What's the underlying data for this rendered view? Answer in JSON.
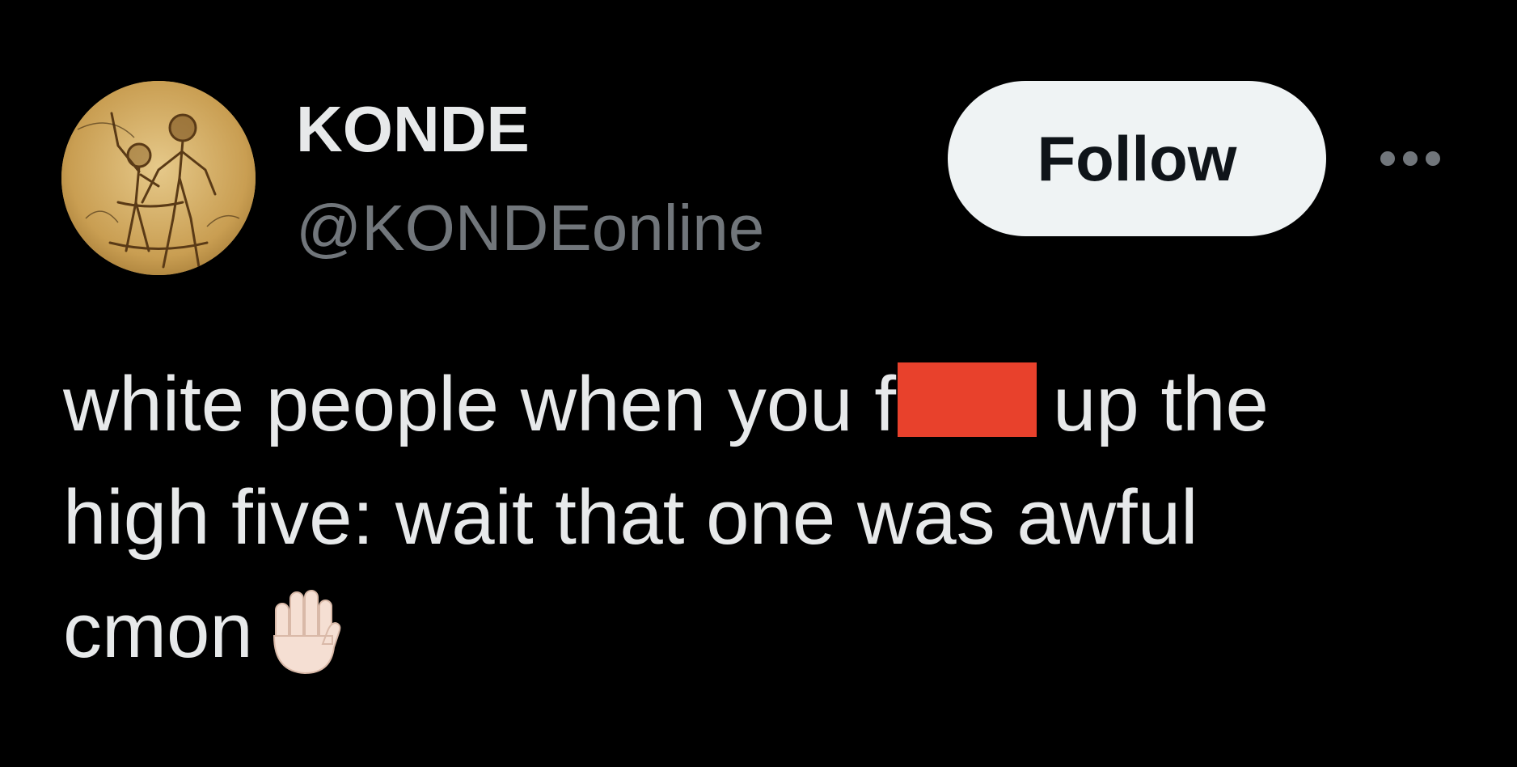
{
  "tweet": {
    "author": {
      "display_name": "KONDE",
      "handle": "@KONDEonline",
      "avatar_icon": "sketch-figures-avatar"
    },
    "follow_label": "Follow",
    "more_icon": "more-horizontal-icon",
    "text": {
      "line1_before": "white people when you f",
      "line1_after": "up the",
      "line2": "high five: wait that one was awful",
      "line3": "cmon"
    },
    "redaction_color": "#e8412c",
    "emoji": "raised-hand-icon"
  },
  "colors": {
    "background": "#000000",
    "primary_text": "#e7e9ea",
    "secondary_text": "#71767b",
    "follow_bg": "#eff3f4",
    "follow_text": "#0f1419"
  }
}
